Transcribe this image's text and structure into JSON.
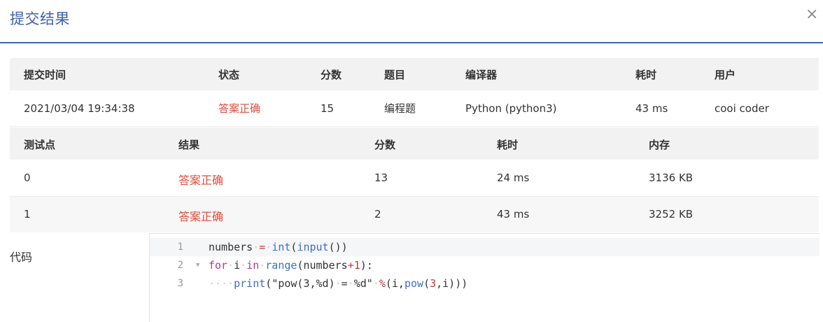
{
  "dialog": {
    "title": "提交结果",
    "close_icon": "×"
  },
  "submission": {
    "headers": [
      "提交时间",
      "状态",
      "分数",
      "题目",
      "编译器",
      "耗时",
      "用户"
    ],
    "row": {
      "time": "2021/03/04 19:34:38",
      "status": "答案正确",
      "score": "15",
      "problem": "编程题",
      "compiler": "Python (python3)",
      "duration": "43 ms",
      "user": "cooi coder"
    }
  },
  "tests": {
    "headers": [
      "测试点",
      "结果",
      "分数",
      "耗时",
      "内存"
    ],
    "rows": [
      {
        "id": "0",
        "result": "答案正确",
        "score": "13",
        "time": "24 ms",
        "memory": "3136 KB"
      },
      {
        "id": "1",
        "result": "答案正确",
        "score": "2",
        "time": "43 ms",
        "memory": "3252 KB"
      }
    ]
  },
  "code": {
    "label": "代码",
    "line_numbers": [
      "1",
      "2",
      "3"
    ],
    "lines": [
      "numbers = int(input())",
      "for i in range(numbers+1):",
      "    print(\"pow(3,%d) = %d\" %(i,pow(3,i)))"
    ]
  },
  "colors": {
    "accent": "#3e62aa",
    "status_ok": "#e04b3c"
  }
}
